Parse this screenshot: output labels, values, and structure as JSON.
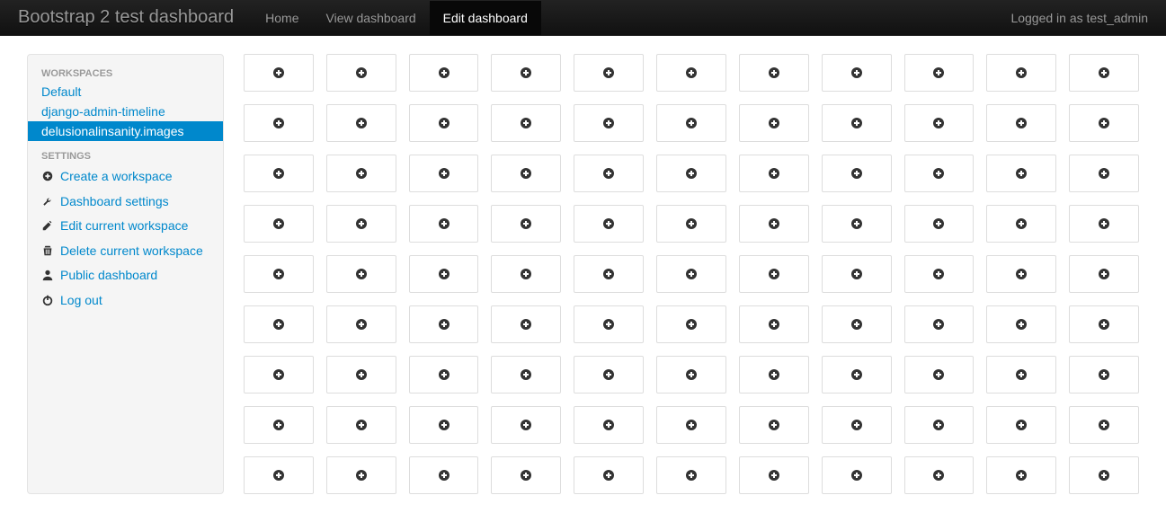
{
  "navbar": {
    "brand": "Bootstrap 2 test dashboard",
    "items": [
      {
        "label": "Home",
        "active": false
      },
      {
        "label": "View dashboard",
        "active": false
      },
      {
        "label": "Edit dashboard",
        "active": true
      }
    ],
    "user_text": "Logged in as test_admin"
  },
  "sidebar": {
    "workspaces_header": "Workspaces",
    "workspaces": [
      {
        "label": "Default",
        "active": false
      },
      {
        "label": "django-admin-timeline",
        "active": false
      },
      {
        "label": "delusionalinsanity.images",
        "active": true
      }
    ],
    "settings_header": "Settings",
    "settings": [
      {
        "label": "Create a workspace",
        "icon": "plus-circle-icon"
      },
      {
        "label": "Dashboard settings",
        "icon": "wrench-icon"
      },
      {
        "label": "Edit current workspace",
        "icon": "edit-icon"
      },
      {
        "label": "Delete current workspace",
        "icon": "trash-icon"
      },
      {
        "label": "Public dashboard",
        "icon": "user-icon"
      },
      {
        "label": "Log out",
        "icon": "power-icon"
      }
    ]
  },
  "grid": {
    "rows": 9,
    "cols": 11
  }
}
